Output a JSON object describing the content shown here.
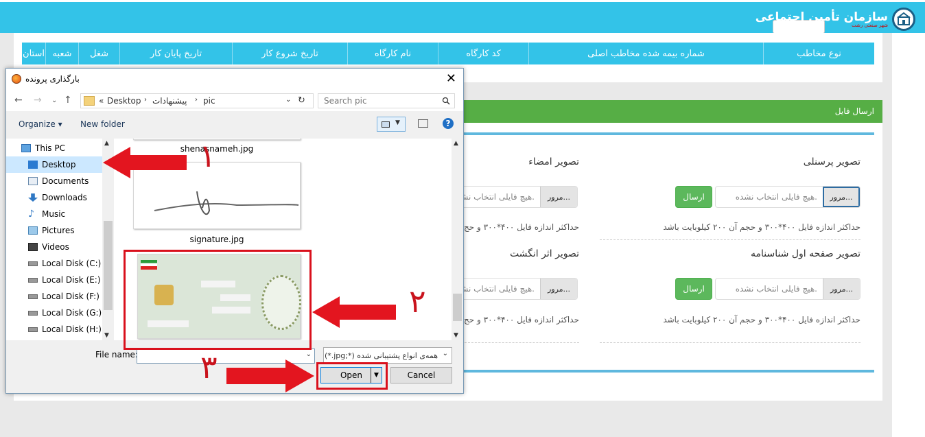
{
  "header": {
    "logo_title": "سازمان تأمین اجتماعی",
    "logo_subtitle": "شهر صنعتی رشت"
  },
  "table_headers": [
    "نوع مخاطب",
    "شماره بیمه شده مخاطب اصلی",
    "کد کارگاه",
    "نام کارگاه",
    "تاریخ شروع کار",
    "تاریخ پایان کار",
    "شغل",
    "شعبه",
    "استان"
  ],
  "upload_panel": {
    "title": "ارسال فایل",
    "fields": {
      "personal": {
        "label": "تصویر پرسنلی",
        "hint": "حداکثر اندازه فایل ۴۰۰*۳۰۰ و حجم آن ۲۰۰ کیلوبایت باشد"
      },
      "signature": {
        "label": "تصویر امضاء",
        "hint": "حداکثر اندازه فایل ۴۰۰*۳۰۰ و حج"
      },
      "birth_cert": {
        "label": "تصویر صفحه اول شناسنامه",
        "hint": "حداکثر اندازه فایل ۴۰۰*۳۰۰ و حجم آن ۲۰۰ کیلوبایت باشد"
      },
      "fingerprint": {
        "label": "تصویر اثر انگشت",
        "hint": "حداکثر اندازه فایل ۴۰۰*۳۰۰ و حج"
      }
    },
    "browse_label": "مرور...",
    "no_file_placeholder": "هیچ فایلی انتخاب نشده.",
    "send_label": "ارسال"
  },
  "dialog": {
    "title": "بارگذاری پرونده",
    "close": "✕",
    "breadcrumb": [
      "Desktop",
      "پیشنهادات",
      "pic"
    ],
    "breadcrumb_prefix": "«",
    "search_placeholder": "Search pic",
    "organize": "Organize ▾",
    "new_folder": "New folder",
    "nav_items": [
      "This PC",
      "Desktop",
      "Documents",
      "Downloads",
      "Music",
      "Pictures",
      "Videos",
      "Local Disk (C:)",
      "Local Disk (E:)",
      "Local Disk (F:)",
      "Local Disk (G:)",
      "Local Disk (H:)"
    ],
    "files": [
      "shenasnameh.jpg",
      "signature.jpg"
    ],
    "file_name_label": "File name:",
    "file_type": "(*.jpg;*) همه‌ی انواع پشتیبانی شده",
    "open_label": "Open",
    "cancel_label": "Cancel"
  },
  "annotations": [
    "۱",
    "۲",
    "۳"
  ]
}
